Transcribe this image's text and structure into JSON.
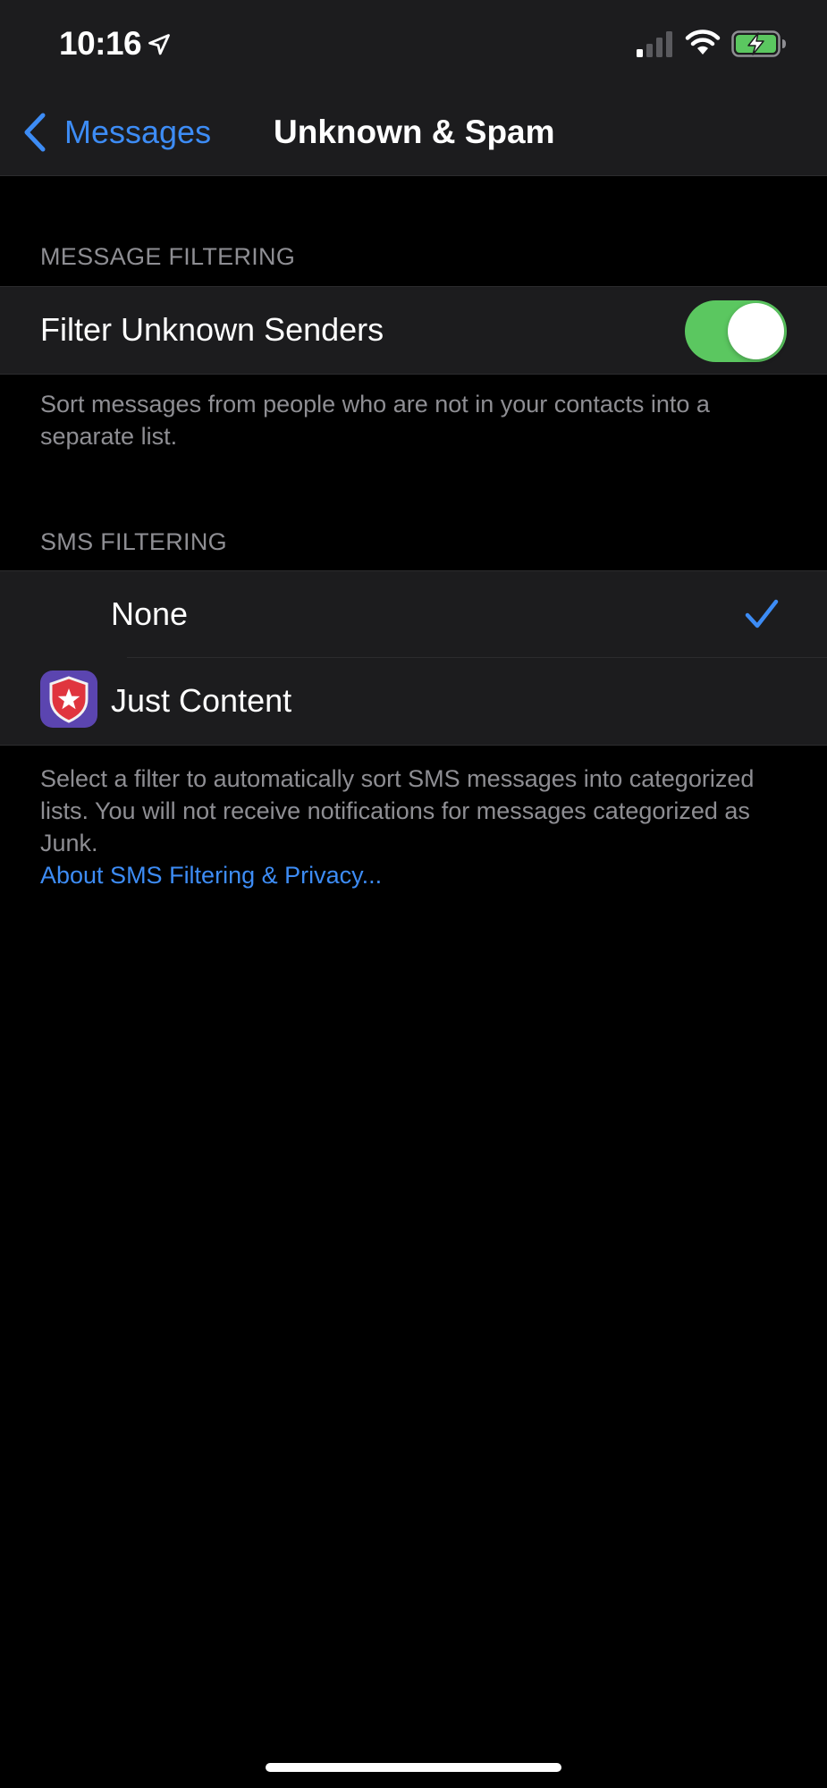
{
  "status_bar": {
    "time": "10:16",
    "icons": [
      "location-arrow-icon",
      "cellular-signal-icon",
      "wifi-icon",
      "battery-charging-icon"
    ]
  },
  "nav": {
    "back_label": "Messages",
    "title": "Unknown & Spam"
  },
  "message_filtering": {
    "header": "MESSAGE FILTERING",
    "filter_unknown_label": "Filter Unknown Senders",
    "filter_unknown_enabled": true,
    "footer": "Sort messages from people who are not in your contacts into a separate list."
  },
  "sms_filtering": {
    "header": "SMS FILTERING",
    "options": [
      {
        "label": "None",
        "selected": true
      },
      {
        "label": "Just Content",
        "selected": false,
        "icon": "just-content-shield-star-icon"
      }
    ],
    "footer": "Select a filter to automatically sort SMS messages into categorized lists. You will not receive notifications for messages categorized as Junk.",
    "footer_link": "About SMS Filtering & Privacy..."
  },
  "colors": {
    "accent": "#3d8cf5",
    "toggle_on": "#5bc760",
    "background": "#000000",
    "cell_background": "#1c1c1e",
    "secondary_text": "#8e8e93"
  }
}
